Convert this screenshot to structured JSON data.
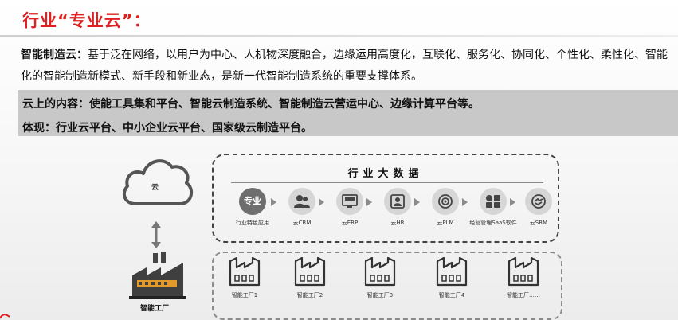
{
  "title": "行业“专业云”：",
  "intro": {
    "term": "智能制造云：",
    "text": "基于泛在网络，以用户为中心、人机物深度融合，边缘运用高度化，互联化、服务化、协同化、个性化、柔性化、智能化的智能制造新模式、新手段和新业态，是新一代智能制造系统的重要支撑体系。"
  },
  "highlights": {
    "content_line": "云上的内容：使能工具集和平台、智能云制造系统、智能制造云营运中心、边缘计算平台等。",
    "embodiment_line": "体现：行业云平台、中小企业云平台、国家级云制造平台。"
  },
  "diagram": {
    "cloud_label": "云",
    "factory_label": "智能工厂",
    "big_data_title": "行业大数据",
    "modules": [
      {
        "icon": "professional-badge-icon",
        "badge": "专业",
        "label": "行业特色应用"
      },
      {
        "icon": "people-icon",
        "label": "云CRM"
      },
      {
        "icon": "erp-icon",
        "label": "云ERP"
      },
      {
        "icon": "id-card-icon",
        "label": "云HR"
      },
      {
        "icon": "target-icon",
        "label": "云PLM"
      },
      {
        "icon": "saas-blocks-icon",
        "label": "经营管理SaaS软件"
      },
      {
        "icon": "handshake-icon",
        "label": "云SRM"
      }
    ],
    "factories": [
      {
        "label": "智能工厂1"
      },
      {
        "label": "智能工厂2"
      },
      {
        "label": "智能工厂3"
      },
      {
        "label": "智能工厂4"
      },
      {
        "label": "智能工厂……"
      }
    ]
  },
  "colors": {
    "title": "#e02020",
    "band": "#c8c8c8",
    "icon_dark": "#444444"
  }
}
